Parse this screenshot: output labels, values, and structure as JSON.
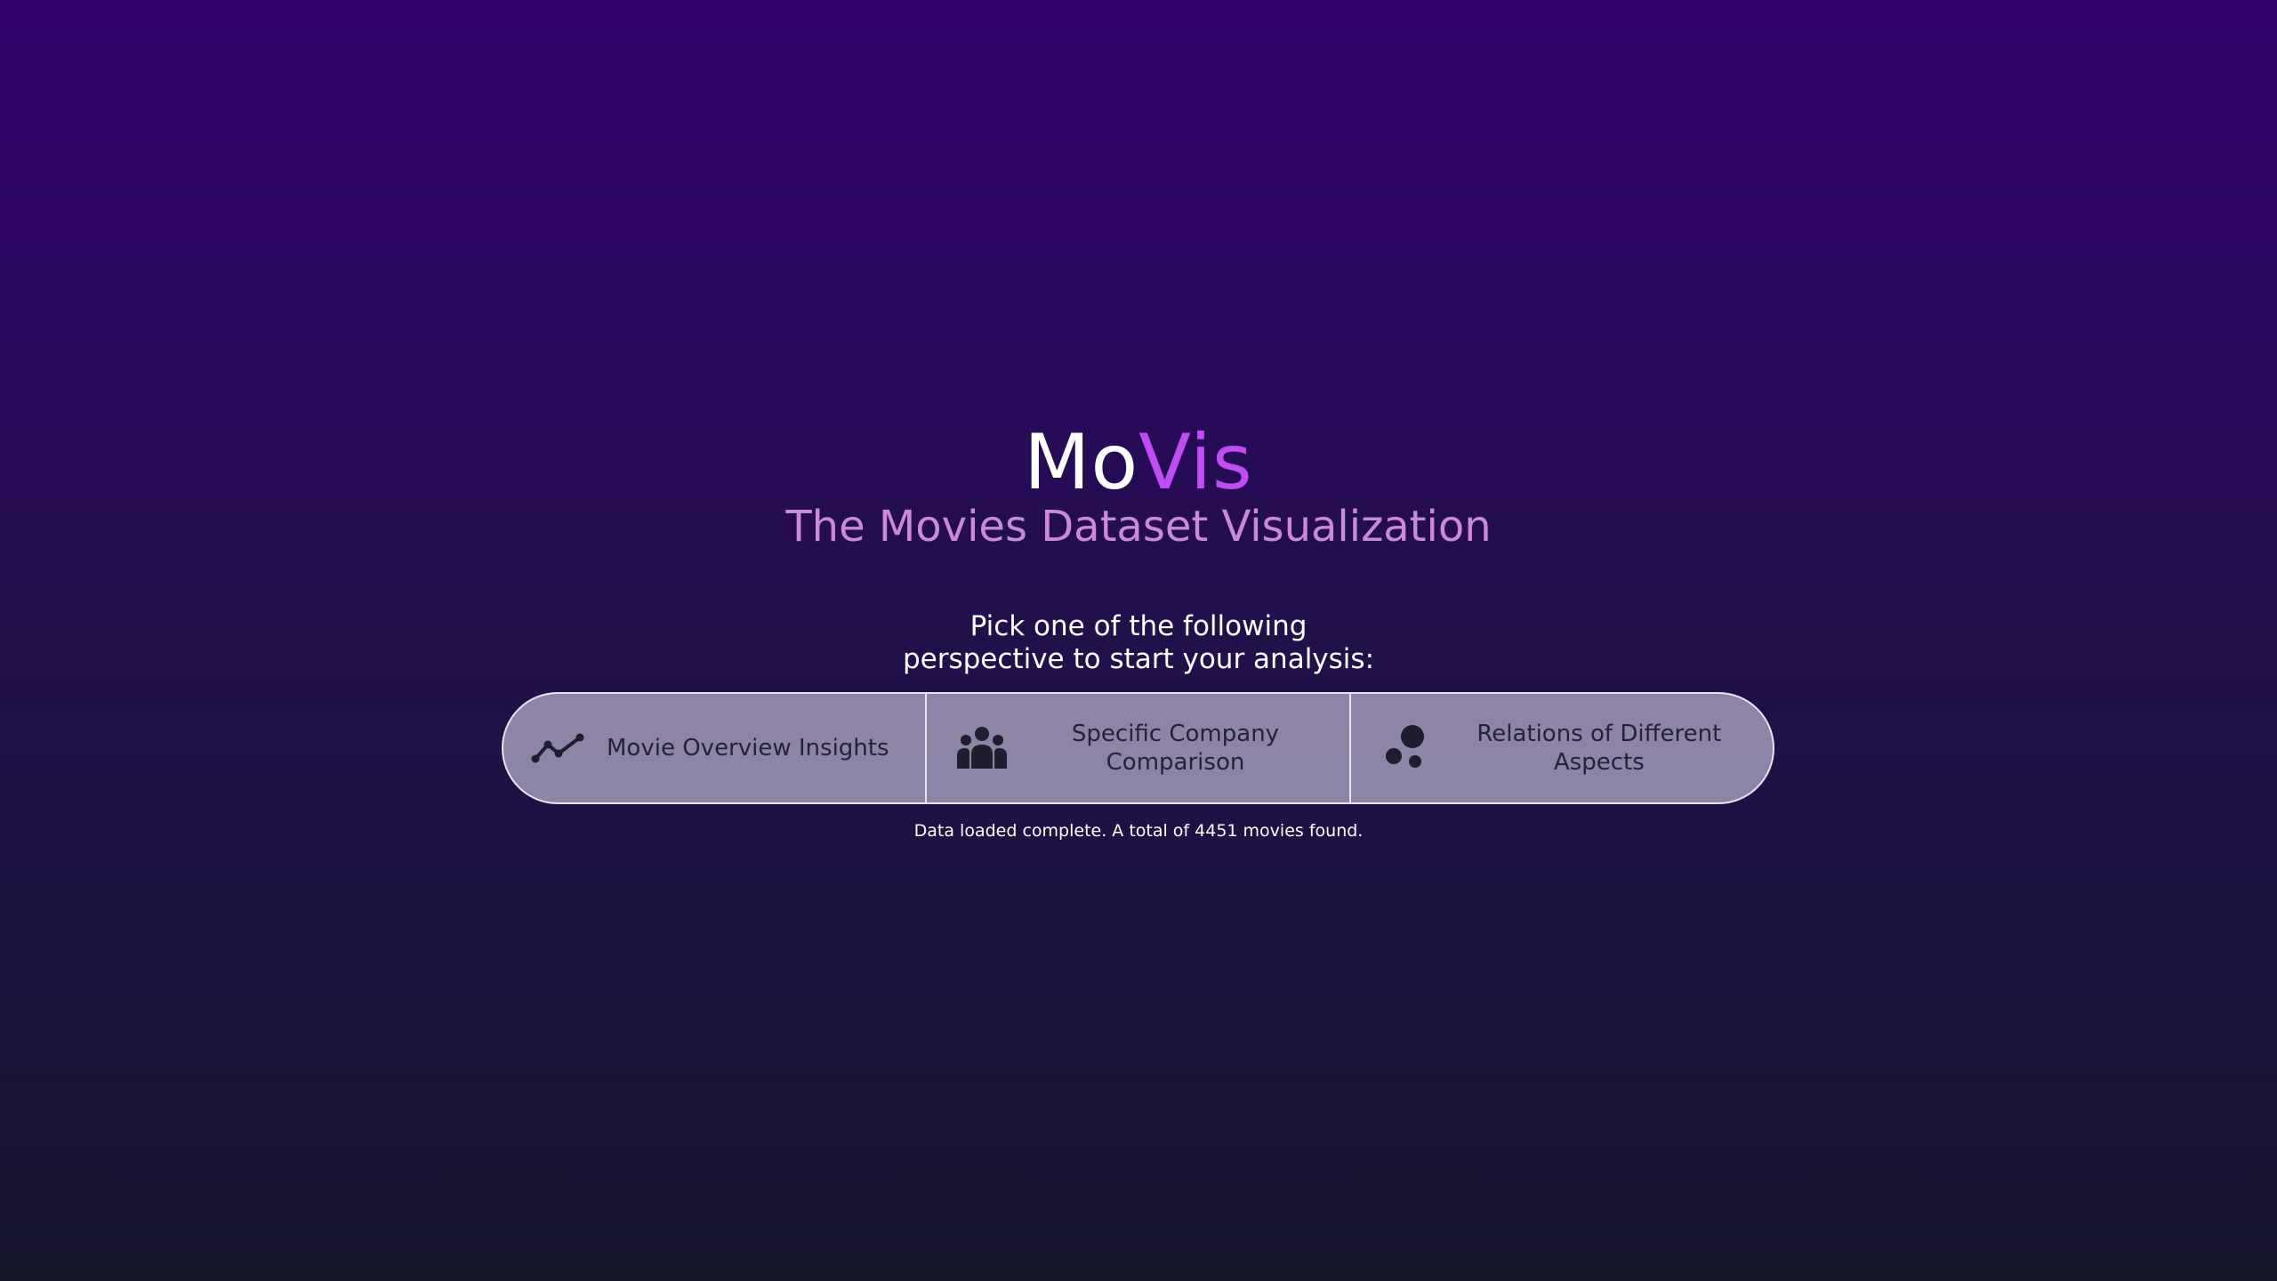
{
  "app": {
    "logo_part1": "Mo",
    "logo_part2": "Vis",
    "subtitle": "The Movies Dataset Visualization"
  },
  "prompt": {
    "line1": "Pick one of the following",
    "line2": "perspective to start your analysis:"
  },
  "options": [
    {
      "label": "Movie Overview Insights",
      "icon": "line-chart-icon"
    },
    {
      "label": "Specific Company Comparison",
      "icon": "group-icon"
    },
    {
      "label": "Relations of Different Aspects",
      "icon": "bubbles-icon"
    }
  ],
  "status": {
    "text": "Data loaded complete. A total of 4451 movies found."
  },
  "colors": {
    "accent": "#c04cf5",
    "subtitle": "#c98ad9",
    "icon": "#1f1d2e"
  }
}
